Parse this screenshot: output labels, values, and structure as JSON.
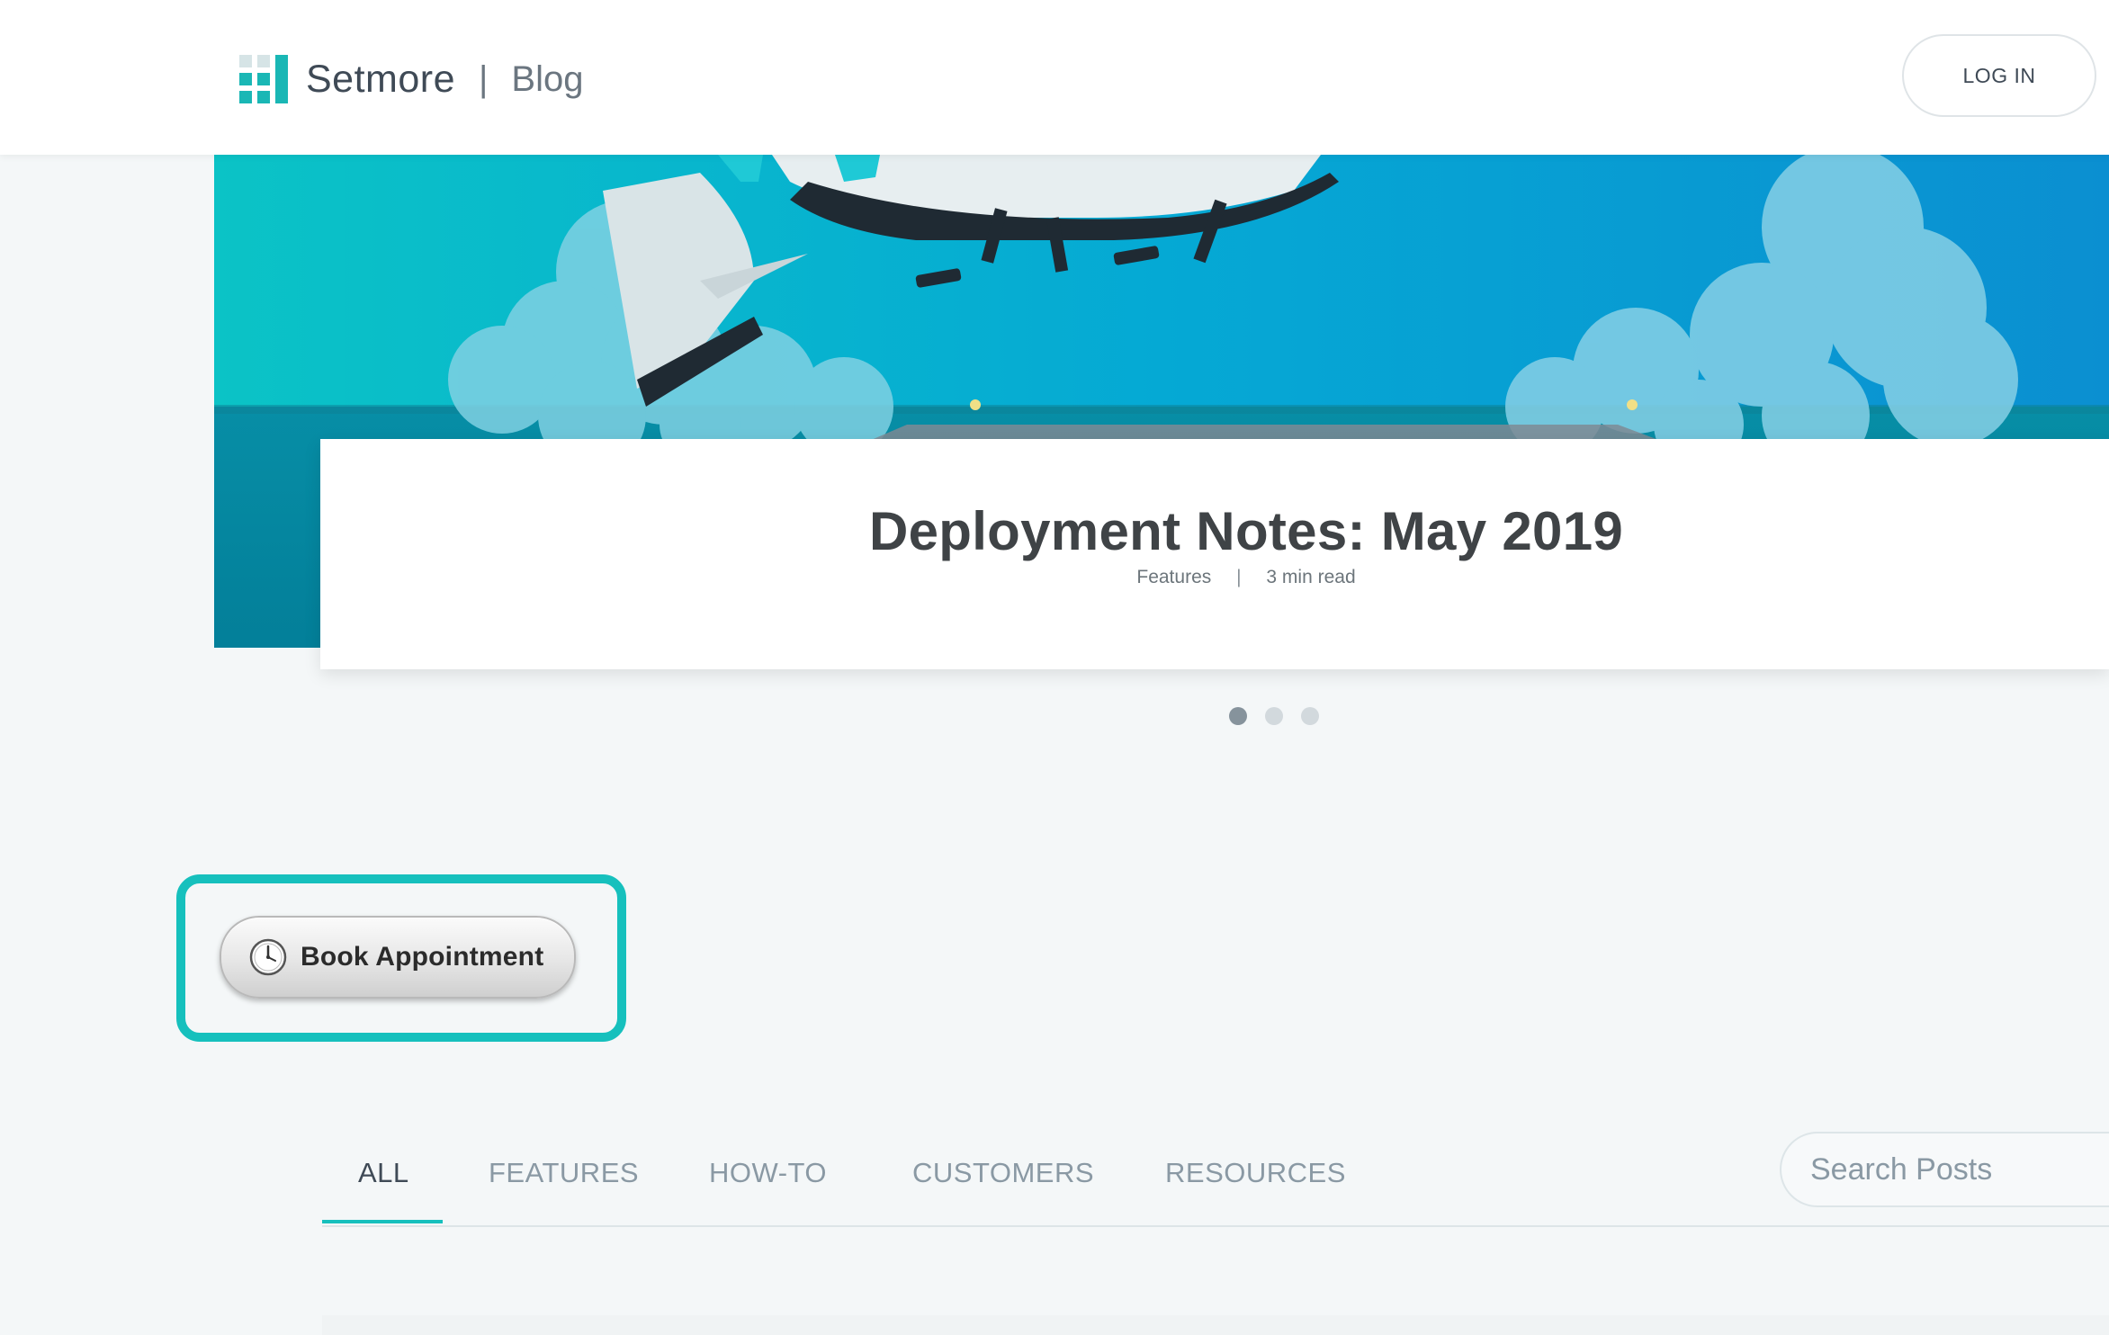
{
  "header": {
    "brand_name": "Setmore",
    "divider": "|",
    "section": "Blog",
    "login_label": "LOG IN"
  },
  "hero": {
    "title": "Deployment Notes: May 2019",
    "category": "Features",
    "separator": "|",
    "read_time": "3 min read",
    "slides_total": 3,
    "active_slide": 1
  },
  "book_button": {
    "label": "Book Appointment"
  },
  "tabs": [
    {
      "label": "ALL",
      "active": true
    },
    {
      "label": "FEATURES",
      "active": false
    },
    {
      "label": "HOW-TO",
      "active": false
    },
    {
      "label": "CUSTOMERS",
      "active": false
    },
    {
      "label": "RESOURCES",
      "active": false
    }
  ],
  "search": {
    "placeholder": "Search Posts"
  },
  "colors": {
    "accent": "#16c0bd",
    "text_dark": "#3f4a56",
    "text_muted": "#8a99a4",
    "hero_blue": "#0388ab"
  },
  "icons": {
    "logo": "setmore-bars-logo",
    "clock": "clock-icon"
  }
}
